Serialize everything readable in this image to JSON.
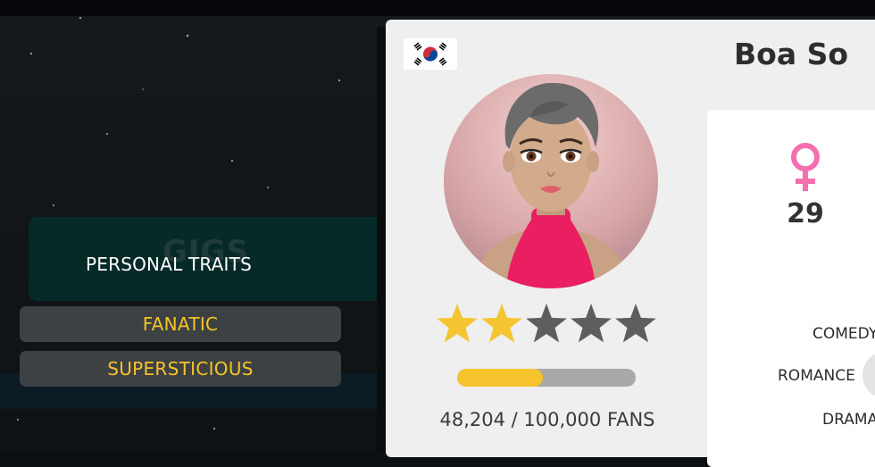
{
  "background": {
    "theme": "starry-space",
    "color": "#0c1013"
  },
  "traits_panel": {
    "tab_ghost_label": "GIGS",
    "title": "PERSONAL TRAITS",
    "traits": [
      "FANATIC",
      "SUPERSTICIOUS"
    ],
    "trait_color": "#f7c426"
  },
  "profile": {
    "flag_icon": "south-korea-flag-icon",
    "name": "Boa So",
    "gender_icon": "female-icon",
    "gender_color": "#f36fb0",
    "age": "29",
    "rating": {
      "value": 2,
      "max": 5,
      "filled_color": "#f4c531",
      "empty_color": "#5e5e5e"
    },
    "fans": {
      "current": "48,204",
      "separator": "/",
      "goal": "100,000",
      "suffix": "FANS",
      "progress_fraction": 0.48204,
      "progress_color": "#f8c42d"
    },
    "genres": [
      "COMEDY",
      "ROMANCE",
      "DRAMA"
    ]
  }
}
